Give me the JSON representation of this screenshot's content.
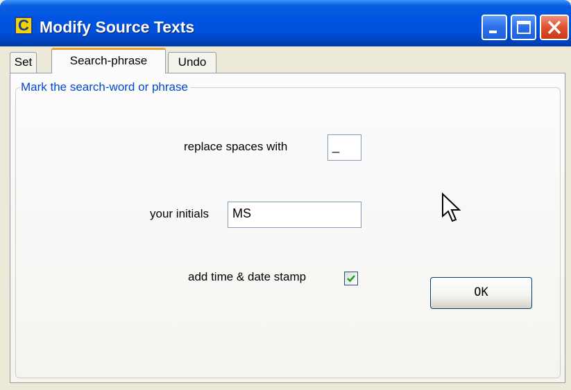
{
  "window": {
    "title": "Modify Source Texts",
    "app_icon_letter": "C",
    "controls": [
      "minimize",
      "maximize",
      "close"
    ]
  },
  "tabs": [
    {
      "label": "Set",
      "active": false
    },
    {
      "label": "Search-phrase",
      "active": true
    },
    {
      "label": "Undo",
      "active": false
    }
  ],
  "group": {
    "legend": "Mark the search-word or phrase"
  },
  "form": {
    "replace_spaces_label": "replace spaces with",
    "replace_spaces_value": "_",
    "initials_label": "your initials",
    "initials_value": "MS",
    "timestamp_label": "add time & date stamp",
    "timestamp_checked": true,
    "ok_label": "OK"
  },
  "colors": {
    "titlebar": "#0054e3",
    "legend_text": "#0046d5",
    "active_tab_accent": "#f0a230",
    "checkmark": "#21a121"
  }
}
